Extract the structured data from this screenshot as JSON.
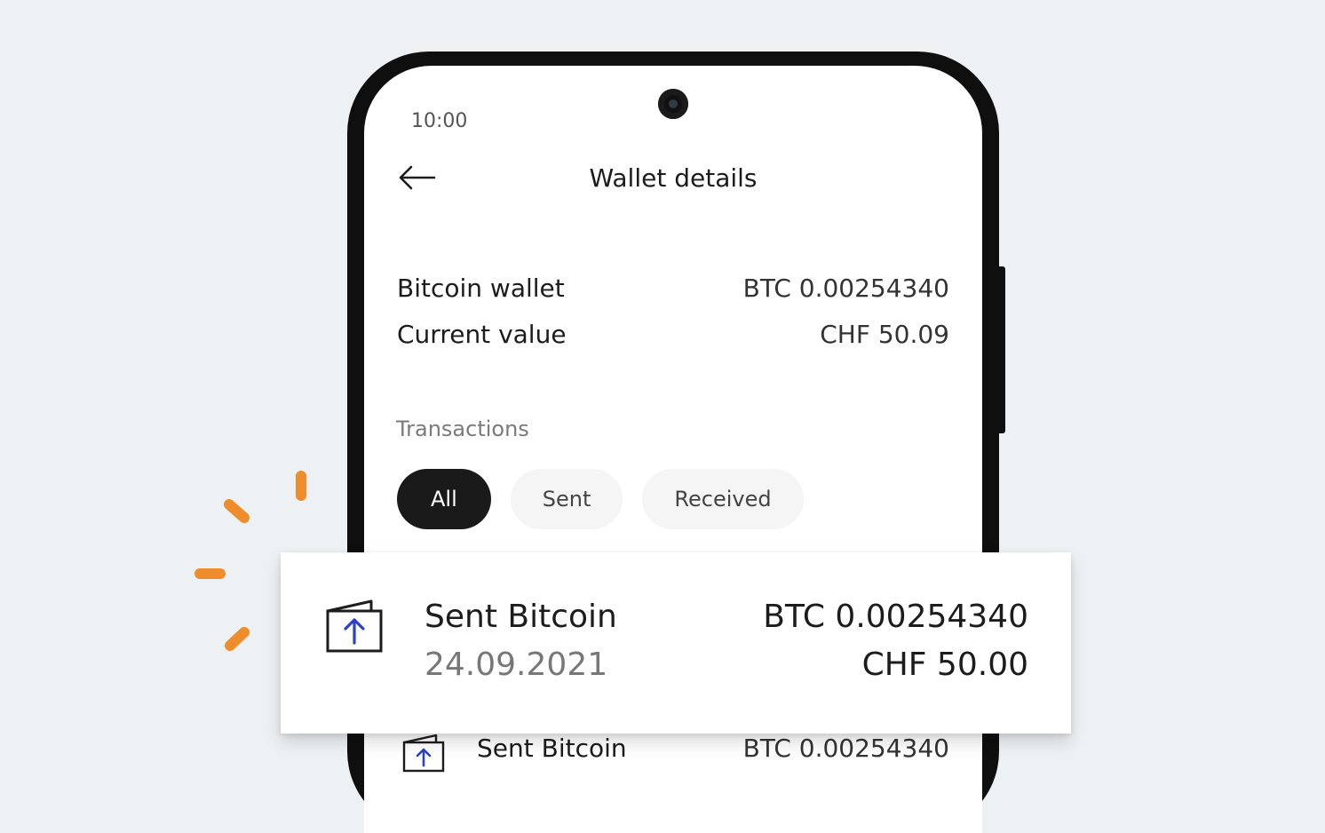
{
  "status_bar": {
    "time": "10:00"
  },
  "header": {
    "title": "Wallet details",
    "back_icon": "arrow-left-icon"
  },
  "wallet": {
    "rows": [
      {
        "label": "Bitcoin wallet",
        "value": "BTC 0.00254340"
      },
      {
        "label": "Current value",
        "value": "CHF 50.09"
      }
    ]
  },
  "transactions": {
    "section_label": "Transactions",
    "filters": [
      {
        "label": "All",
        "active": true
      },
      {
        "label": "Sent",
        "active": false
      },
      {
        "label": "Received",
        "active": false
      }
    ],
    "highlighted": {
      "icon": "wallet-send-icon",
      "title": "Sent Bitcoin",
      "date": "24.09.2021",
      "amount_btc": "BTC 0.00254340",
      "amount_fiat": "CHF 50.00"
    },
    "list_item": {
      "icon": "wallet-send-icon",
      "title": "Sent Bitcoin",
      "amount_btc": "BTC 0.00254340"
    }
  },
  "colors": {
    "background": "#eef1f4",
    "accent_orange": "#ef8c2c",
    "icon_blue": "#2b3fcc",
    "chip_active": "#1a1a1a",
    "chip_inactive": "#f5f5f5"
  }
}
